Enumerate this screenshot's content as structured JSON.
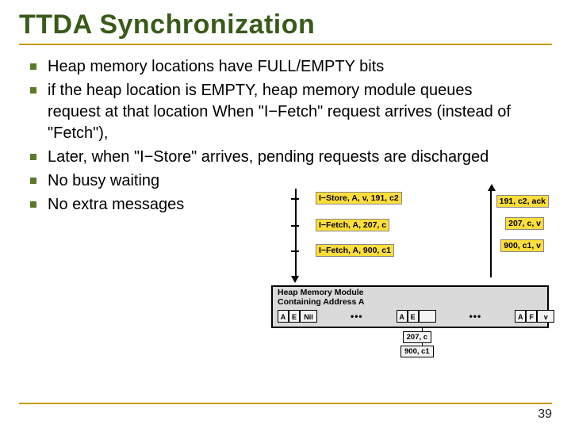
{
  "title": "TTDA Synchronization",
  "bullets": [
    "Heap memory locations have FULL/EMPTY bits",
    "if the heap location is EMPTY,  heap memory module queues request at that location When \"I−Fetch\" request arrives (instead of \"Fetch\"),",
    "Later, when \"I−Store\" arrives, pending requests are discharged",
    "No busy waiting",
    "No extra messages"
  ],
  "diagram": {
    "hmm_label_line1": "Heap Memory Module",
    "hmm_label_line2": "Containing Address A",
    "row1": {
      "a": "A",
      "b": "E",
      "c": "Nil"
    },
    "row2": {
      "a": "A",
      "b": "E",
      "c": ""
    },
    "row3": {
      "a": "A",
      "b": "F",
      "c": "v"
    },
    "dots": "•••",
    "pending1": "207, c",
    "pending2": "900, c1",
    "left_labels": [
      "I−Store, A, v, 191, c2",
      "I−Fetch, A, 207, c",
      "I−Fetch, A, 900, c1"
    ],
    "right_labels": [
      "191, c2, ack",
      "207, c, v",
      "900, c1, v"
    ]
  },
  "page_number": "39"
}
